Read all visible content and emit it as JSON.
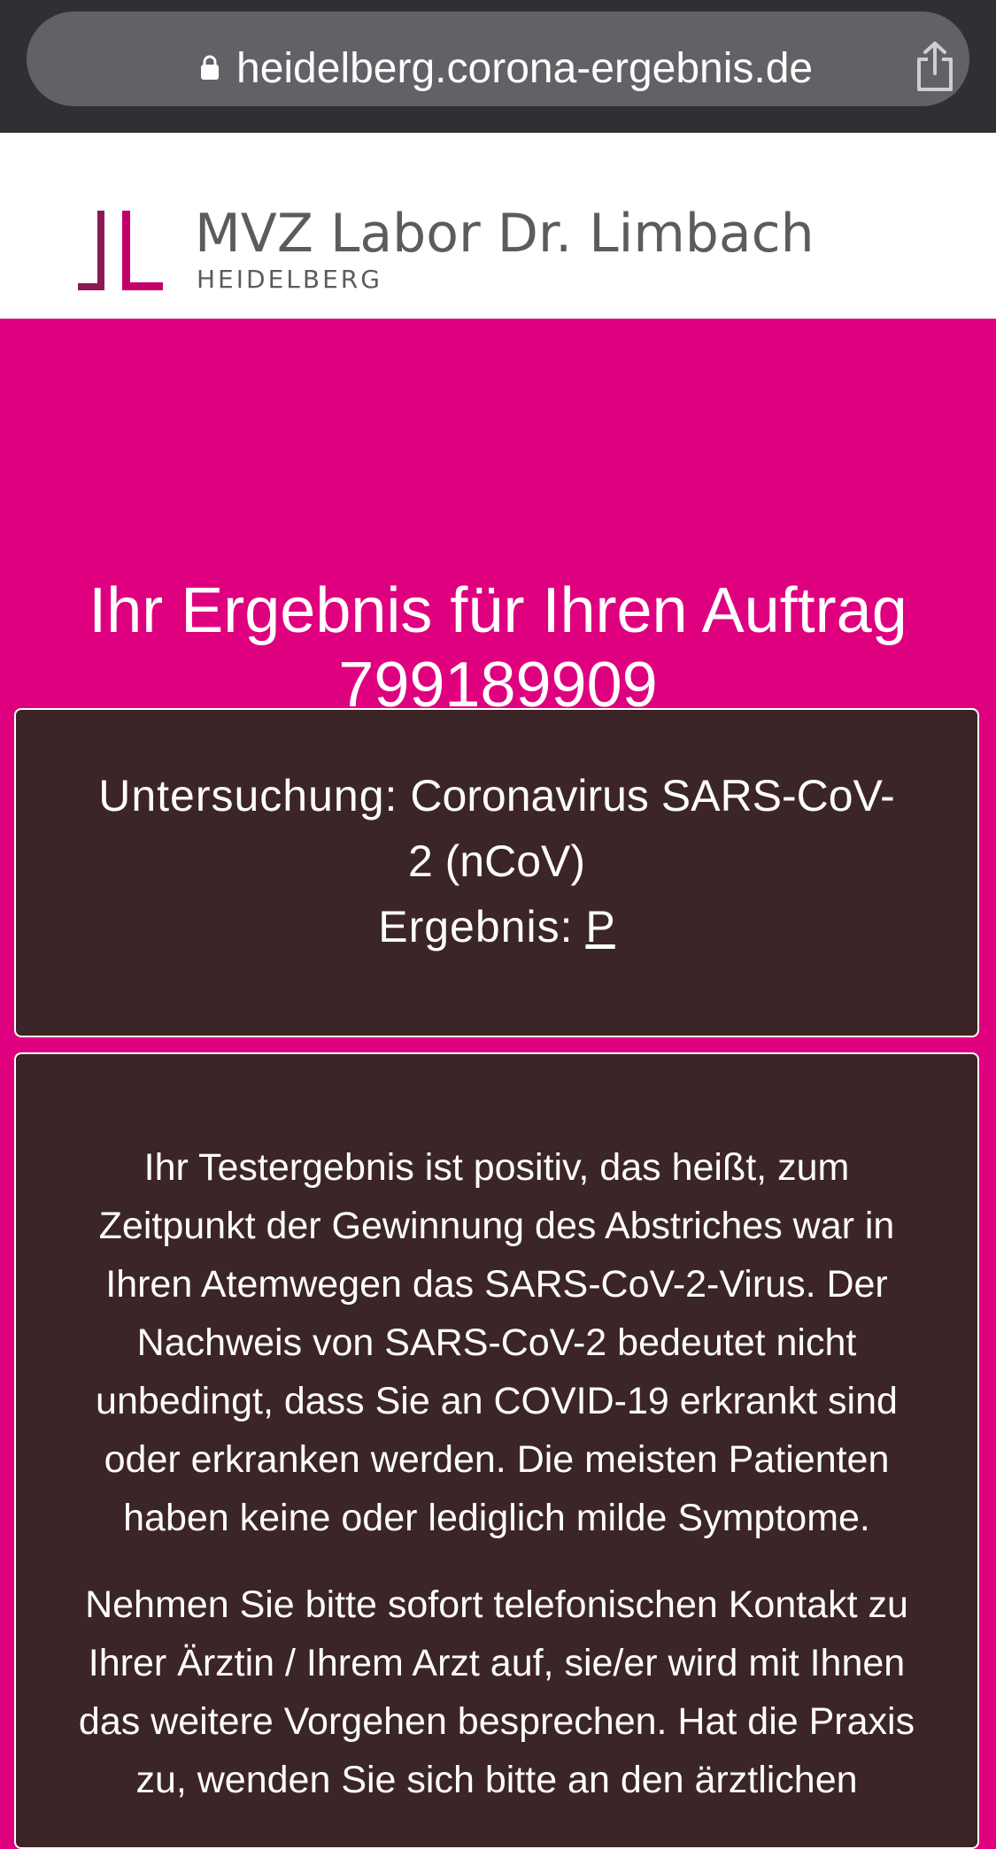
{
  "browser": {
    "url": "heidelberg.corona-ergebnis.de",
    "lock_icon": "lock-icon",
    "share_icon": "share-icon"
  },
  "header": {
    "logo_name": "MVZ Labor Dr. Limbach",
    "logo_city": "HEIDELBERG",
    "logo_colors": [
      "#b0005c",
      "#8a1a55"
    ]
  },
  "main": {
    "title_line1": "Ihr Ergebnis für Ihren Auftrag",
    "title_line2": "799189909"
  },
  "result": {
    "exam_label": "Untersuchung:",
    "exam_value": "Coronavirus SARS-CoV-2 (nCoV)",
    "result_label": "Ergebnis:",
    "result_value": "P"
  },
  "info": {
    "paragraph1": "Ihr Testergebnis ist positiv, das heißt, zum Zeitpunkt der Gewinnung des Abstriches war in Ihren Atemwegen das SARS-CoV-2-Virus. Der Nachweis von SARS-CoV-2 bedeutet nicht unbedingt, dass Sie an COVID-19 erkrankt sind oder erkranken werden. Die meisten Patienten haben keine oder lediglich milde Symptome.",
    "paragraph2": "Nehmen Sie bitte sofort telefonischen Kontakt zu Ihrer Ärztin / Ihrem Arzt auf, sie/er wird mit Ihnen das weitere Vorgehen besprechen. Hat die Praxis zu, wenden Sie sich bitte an den ärztlichen"
  },
  "colors": {
    "page_background": "#df0080",
    "panel_background": "#3c2526",
    "browser_bar": "#2f3033"
  }
}
